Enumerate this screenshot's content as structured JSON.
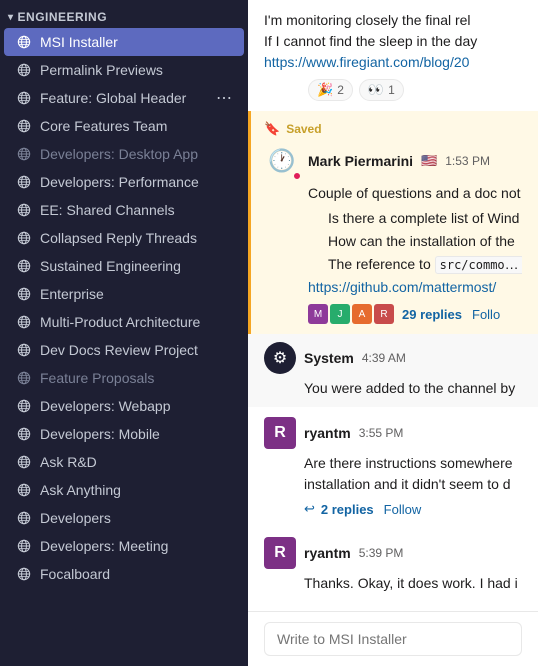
{
  "sidebar": {
    "section_label": "Engineering",
    "chevron": "▾",
    "items": [
      {
        "id": "msi-installer",
        "label": "MSI Installer",
        "muted": false,
        "active": true
      },
      {
        "id": "permalink-previews",
        "label": "Permalink Previews",
        "muted": false,
        "active": false
      },
      {
        "id": "feature-global-header",
        "label": "Feature: Global Header",
        "muted": false,
        "active": false,
        "has_options": true
      },
      {
        "id": "core-features-team",
        "label": "Core Features Team",
        "muted": false,
        "active": false
      },
      {
        "id": "developers-desktop-app",
        "label": "Developers: Desktop App",
        "muted": true,
        "active": false
      },
      {
        "id": "developers-performance",
        "label": "Developers: Performance",
        "muted": false,
        "active": false
      },
      {
        "id": "ee-shared-channels",
        "label": "EE: Shared Channels",
        "muted": false,
        "active": false
      },
      {
        "id": "collapsed-reply-threads",
        "label": "Collapsed Reply Threads",
        "muted": false,
        "active": false
      },
      {
        "id": "sustained-engineering",
        "label": "Sustained Engineering",
        "muted": false,
        "active": false
      },
      {
        "id": "enterprise",
        "label": "Enterprise",
        "muted": false,
        "active": false
      },
      {
        "id": "multi-product-architecture",
        "label": "Multi-Product Architecture",
        "muted": false,
        "active": false
      },
      {
        "id": "dev-docs-review-project",
        "label": "Dev Docs Review Project",
        "muted": false,
        "active": false
      },
      {
        "id": "feature-proposals",
        "label": "Feature Proposals",
        "muted": true,
        "active": false
      },
      {
        "id": "developers-webapp",
        "label": "Developers: Webapp",
        "muted": false,
        "active": false
      },
      {
        "id": "developers-mobile",
        "label": "Developers: Mobile",
        "muted": false,
        "active": false
      },
      {
        "id": "ask-rd",
        "label": "Ask R&D",
        "muted": false,
        "active": false
      },
      {
        "id": "ask-anything",
        "label": "Ask Anything",
        "muted": false,
        "active": false
      },
      {
        "id": "developers",
        "label": "Developers",
        "muted": false,
        "active": false
      },
      {
        "id": "developers-meeting",
        "label": "Developers: Meeting",
        "muted": false,
        "active": false
      },
      {
        "id": "focalboard",
        "label": "Focalboard",
        "muted": false,
        "active": false
      }
    ]
  },
  "chat": {
    "top_message": {
      "text_part1": "I'm monitoring closely the final rel",
      "text_part2": "If I cannot find the sleep in the day",
      "link": "https://www.firegiant.com/blog/20",
      "reactions": [
        {
          "emoji": "🎉",
          "count": "2"
        },
        {
          "emoji": "👀",
          "count": "1"
        }
      ]
    },
    "saved_message": {
      "saved_label": "Saved",
      "author": "Mark Piermarini",
      "flag": "🇺🇸",
      "time": "1:53 PM",
      "text_intro": "Couple of questions and a doc not",
      "list_items": [
        "Is there a complete list of Wind",
        "How can the installation of the",
        "The reference to"
      ],
      "code_snippet": "src/common/",
      "link_text": "https://github.com/mattermost/",
      "reply_count": "29 replies",
      "follow_label": "Follo"
    },
    "system_message": {
      "time": "4:39 AM",
      "text": "You were added to the channel by"
    },
    "ryantm_message1": {
      "author": "ryantm",
      "time": "3:55 PM",
      "text": "Are there instructions somewhere",
      "text2": "installation and it didn't seem to d",
      "reply_count": "2 replies",
      "follow_label": "Follow"
    },
    "ryantm_message2": {
      "author": "ryantm",
      "time": "5:39 PM",
      "text": "Thanks. Okay, it does work. I had i"
    },
    "input_placeholder": "Write to MSI Installer"
  },
  "icons": {
    "globe": "⊕",
    "bookmark": "🔖",
    "chevron_right": "›"
  }
}
